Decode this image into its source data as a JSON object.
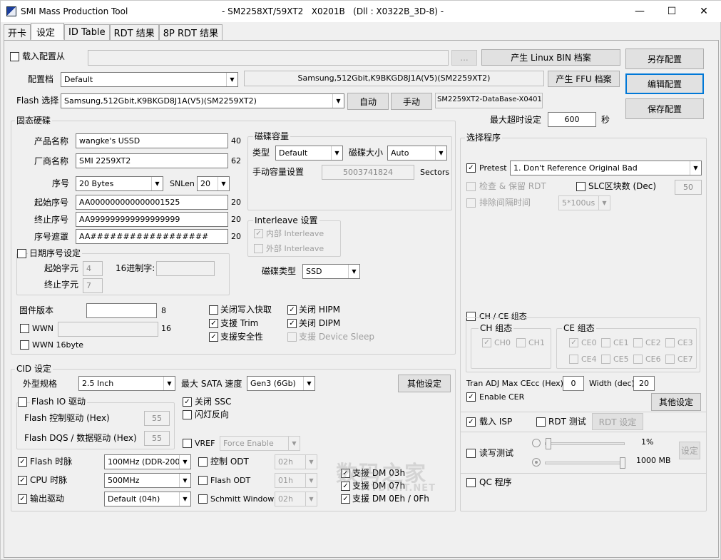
{
  "window": {
    "app": "SMI Mass Production Tool",
    "info": "- SM2258XT/59XT2   X0201B   (Dll : X0322B_3D-8) -",
    "minimize": "—",
    "maximize": "☐",
    "close": "✕"
  },
  "tabs": [
    "开卡",
    "设定",
    "ID Table",
    "RDT 结果",
    "8P RDT 结果"
  ],
  "top": {
    "load_config": "载入配置从",
    "browse": "...",
    "linux_bin": "产生 Linux BIN 档案",
    "save_as": "另存配置",
    "profile_label": "配置档",
    "profile_value": "Default",
    "flash_info": "Samsung,512Gbit,K9BKGD8J1A(V5)(SM2259XT2)",
    "ffu": "产生 FFU 档案",
    "edit_config": "编辑配置",
    "flash_select_label": "Flash 选择",
    "flash_select_value": "Samsung,512Gbit,K9BKGD8J1A(V5)(SM2259XT2)",
    "auto": "自动",
    "manual": "手动",
    "database": "SM2259XT2-DataBase-X0401",
    "save_config": "保存配置",
    "timeout_label": "最大超时设定",
    "timeout_value": "600",
    "timeout_unit": "秒"
  },
  "ssd": {
    "group": "固态硬碟",
    "product_label": "产品名称",
    "product_value": "wangke's USSD",
    "product_len": "40",
    "vendor_label": "厂商名称",
    "vendor_value": "SMI 2259XT2",
    "vendor_len": "62",
    "serial_label": "序号",
    "serial_value": "20 Bytes",
    "snlen_label": "SNLen",
    "snlen_value": "20",
    "start_sn_label": "起始序号",
    "start_sn_value": "AA000000000000001525",
    "start_sn_len": "20",
    "end_sn_label": "终止序号",
    "end_sn_value": "AA999999999999999999",
    "end_sn_len": "20",
    "mask_label": "序号遮罩",
    "mask_value": "AA##################",
    "mask_len": "20",
    "date_sn_label": "日期序号设定",
    "start_char_label": "起始字元",
    "start_char_value": "4",
    "hex_label": "16进制字:",
    "end_char_label": "终止字元",
    "end_char_value": "7",
    "fw_label": "固件版本",
    "fw_len": "8",
    "wwn_label": "WWN",
    "wwn_len": "16",
    "wwn16_label": "WWN 16byte"
  },
  "capacity": {
    "group": "磁碟容量",
    "type_label": "类型",
    "type_value": "Default",
    "size_label": "磁碟大小",
    "size_value": "Auto",
    "manual_label": "手动容量设置",
    "manual_value": "5003741824",
    "sectors": "Sectors"
  },
  "interleave": {
    "group": "Interleave 设置",
    "internal": "内部 Interleave",
    "external": "外部 Interleave"
  },
  "disk_type": {
    "label": "磁碟类型",
    "value": "SSD"
  },
  "features": {
    "close_write_cache": "关闭写入快取",
    "hipm": "关闭 HIPM",
    "trim": "支援 Trim",
    "dipm": "关闭 DIPM",
    "security": "支援安全性",
    "device_sleep": "支援 Device Sleep"
  },
  "cid": {
    "group": "CID 设定",
    "form_label": "外型规格",
    "form_value": "2.5 Inch",
    "sata_label": "最大 SATA 速度",
    "sata_value": "Gen3 (6Gb)",
    "other": "其他设定",
    "flash_io_label": "Flash IO 驱动",
    "flash_ctrl_label": "Flash 控制驱动 (Hex)",
    "flash_ctrl_value": "55",
    "flash_dqs_label": "Flash DQS / 数据驱动 (Hex)",
    "flash_dqs_value": "55",
    "close_ssc": "关闭 SSC",
    "led_invert": "闪灯反向",
    "vref_label": "VREF",
    "vref_value": "Force Enable",
    "flash_clock_label": "Flash 时脉",
    "flash_clock_value": "100MHz (DDR-200)",
    "ctrl_odt_label": "控制 ODT",
    "ctrl_odt_value": "02h",
    "cpu_clock_label": "CPU 时脉",
    "cpu_clock_value": "500MHz",
    "flash_odt_label": "Flash ODT",
    "flash_odt_value": "01h",
    "output_drive_label": "输出驱动",
    "output_drive_value": "Default (04h)",
    "schmitt_label": "Schmitt Window",
    "schmitt_value": "02h",
    "dm03": "支援 DM 03h",
    "dm07": "支援 DM 07h",
    "dm0e": "支援 DM 0Eh / 0Fh"
  },
  "program": {
    "group": "选择程序",
    "pretest_label": "Pretest",
    "pretest_value": "1. Don't Reference Original Bad",
    "check_rdt": "检查 & 保留 RDT",
    "slc_label": "SLC区块数  (Dec)",
    "slc_value": "50",
    "exclude_label": "排除间隔时间",
    "exclude_value": "5*100us",
    "chce_label": "CH / CE 组态",
    "ch_group": "CH 组态",
    "ch0": "CH0",
    "ch1": "CH1",
    "ce_group": "CE 组态",
    "ce0": "CE0",
    "ce1": "CE1",
    "ce2": "CE2",
    "ce3": "CE3",
    "ce4": "CE4",
    "ce5": "CE5",
    "ce6": "CE6",
    "ce7": "CE7",
    "tran_label": "Tran ADJ Max CEcc (Hex)",
    "tran_value": "0",
    "width_label": "Width (dec)",
    "width_value": "20",
    "enable_cer": "Enable CER",
    "other": "其他设定",
    "load_isp": "载入 ISP",
    "rdt_test": "RDT 测试",
    "rdt_setting": "RDT 设定",
    "rw_test": "读写测试",
    "pct": "1%",
    "mb": "1000 MB",
    "setting": "设定",
    "qc": "QC 程序"
  },
  "watermark": {
    "brand": "数码之家",
    "url": "MYDIGIT.NET"
  }
}
